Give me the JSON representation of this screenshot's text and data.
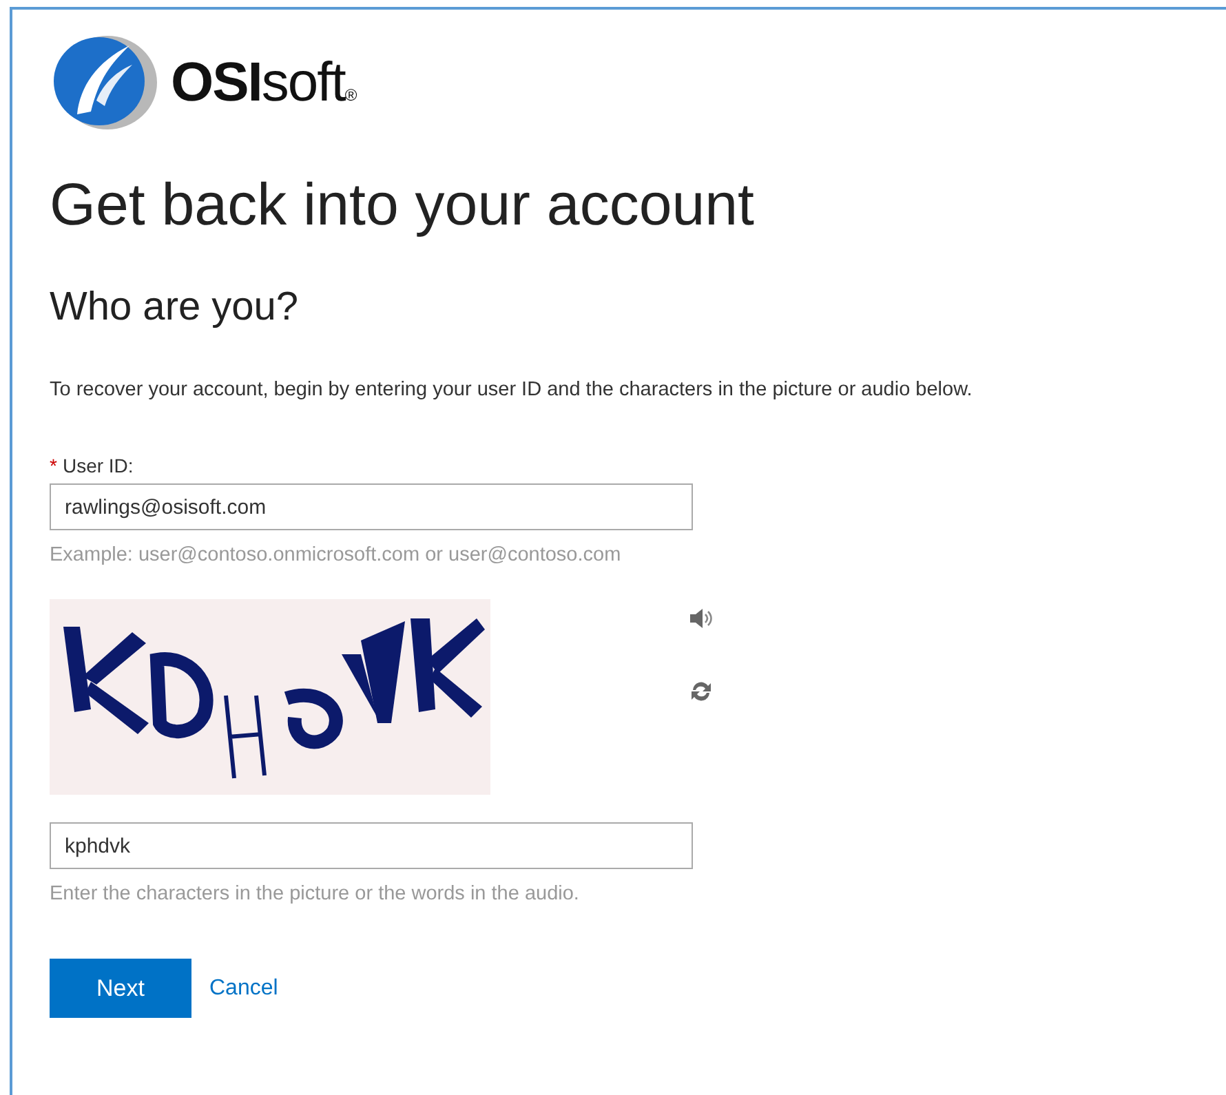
{
  "logo": {
    "brand": "**OSI**soft",
    "mark": "®"
  },
  "title": "Get back into your account",
  "subtitle": "Who are you?",
  "instructions": "To recover your account, begin by entering your user ID and the characters in the picture or audio below.",
  "user_id": {
    "required_mark": "*",
    "label": "User ID:",
    "value": "rawlings@osisoft.com",
    "example": "Example: user@contoso.onmicrosoft.com or user@contoso.com"
  },
  "captcha": {
    "kind": "picture",
    "value": "kphdvk",
    "hint": "Enter the characters in the picture or the words in the audio."
  },
  "buttons": [
    {
      "kind": "primary",
      "label": "Next"
    },
    {
      "kind": "link",
      "label": "Cancel"
    }
  ]
}
